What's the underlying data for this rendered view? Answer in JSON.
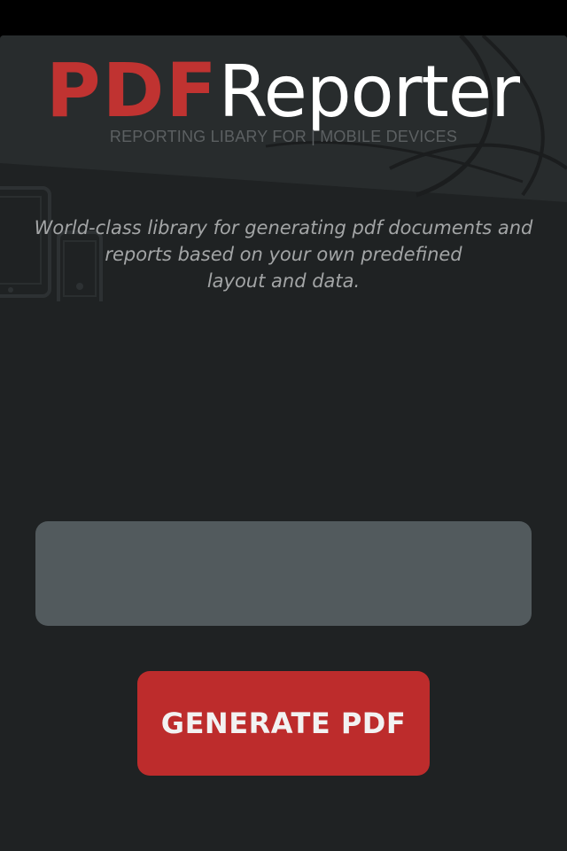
{
  "app": {
    "logo_part1": "PDF",
    "logo_part2": "Reporter",
    "tagline": "REPORTING LIBARY FOR | MOBILE DEVICES"
  },
  "description": {
    "line1": "World-class library for generating pdf documents and",
    "line2": "reports based on your own predefined",
    "line3": "layout and data."
  },
  "input": {
    "value": "",
    "placeholder": ""
  },
  "actions": {
    "generate_label": "GENERATE PDF"
  },
  "colors": {
    "background": "#1f2223",
    "logo_red": "#c03331",
    "logo_white": "#ffffff",
    "tagline": "#5c6062",
    "description": "#a3a5a6",
    "input_bg": "#525a5d",
    "button_bg": "#bd2c2c",
    "button_text": "#f2f2f2"
  },
  "icons": {
    "tablet": "tablet-icon",
    "phone": "phone-icon"
  }
}
